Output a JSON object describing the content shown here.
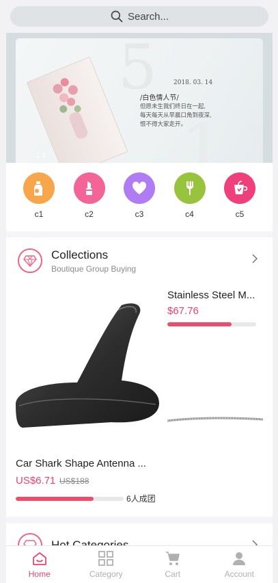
{
  "search": {
    "placeholder": "Search..."
  },
  "banner": {
    "date": "2018. 03. 14",
    "title": "/白色情人节/",
    "lines": [
      "但愿未生我们终日在一起,",
      "每天每天从早晨口角到夜深,",
      "恨不得大家走开。"
    ],
    "indicator": "1 3"
  },
  "categories": [
    {
      "label": "c1",
      "color": "#f7a64c",
      "icon": "bottle-icon"
    },
    {
      "label": "c2",
      "color": "#f36497",
      "icon": "lipstick-icon"
    },
    {
      "label": "c3",
      "color": "#b07cf3",
      "icon": "heart-icon"
    },
    {
      "label": "c4",
      "color": "#98c33d",
      "icon": "fork-icon"
    },
    {
      "label": "c5",
      "color": "#f0407c",
      "icon": "cup-icon"
    }
  ],
  "collections": {
    "title": "Collections",
    "subtitle": "Boutique Group Buying",
    "featured": {
      "name": "Car Shark Shape Antenna ...",
      "price": "US$6.71",
      "old_price": "US$188",
      "progress": 0.72,
      "group_text": "6人成团"
    },
    "side": {
      "name": "Stainless Steel M...",
      "price": "$67.76",
      "progress": 0.72
    }
  },
  "hot": {
    "title": "Hot Categories"
  },
  "tabs": [
    {
      "label": "Home",
      "icon": "home-icon",
      "active": true
    },
    {
      "label": "Category",
      "icon": "category-icon",
      "active": false
    },
    {
      "label": "Cart",
      "icon": "cart-icon",
      "active": false
    },
    {
      "label": "Account",
      "icon": "account-icon",
      "active": false
    }
  ],
  "colors": {
    "accent": "#f0416c",
    "inactive": "#b0b0b0"
  }
}
